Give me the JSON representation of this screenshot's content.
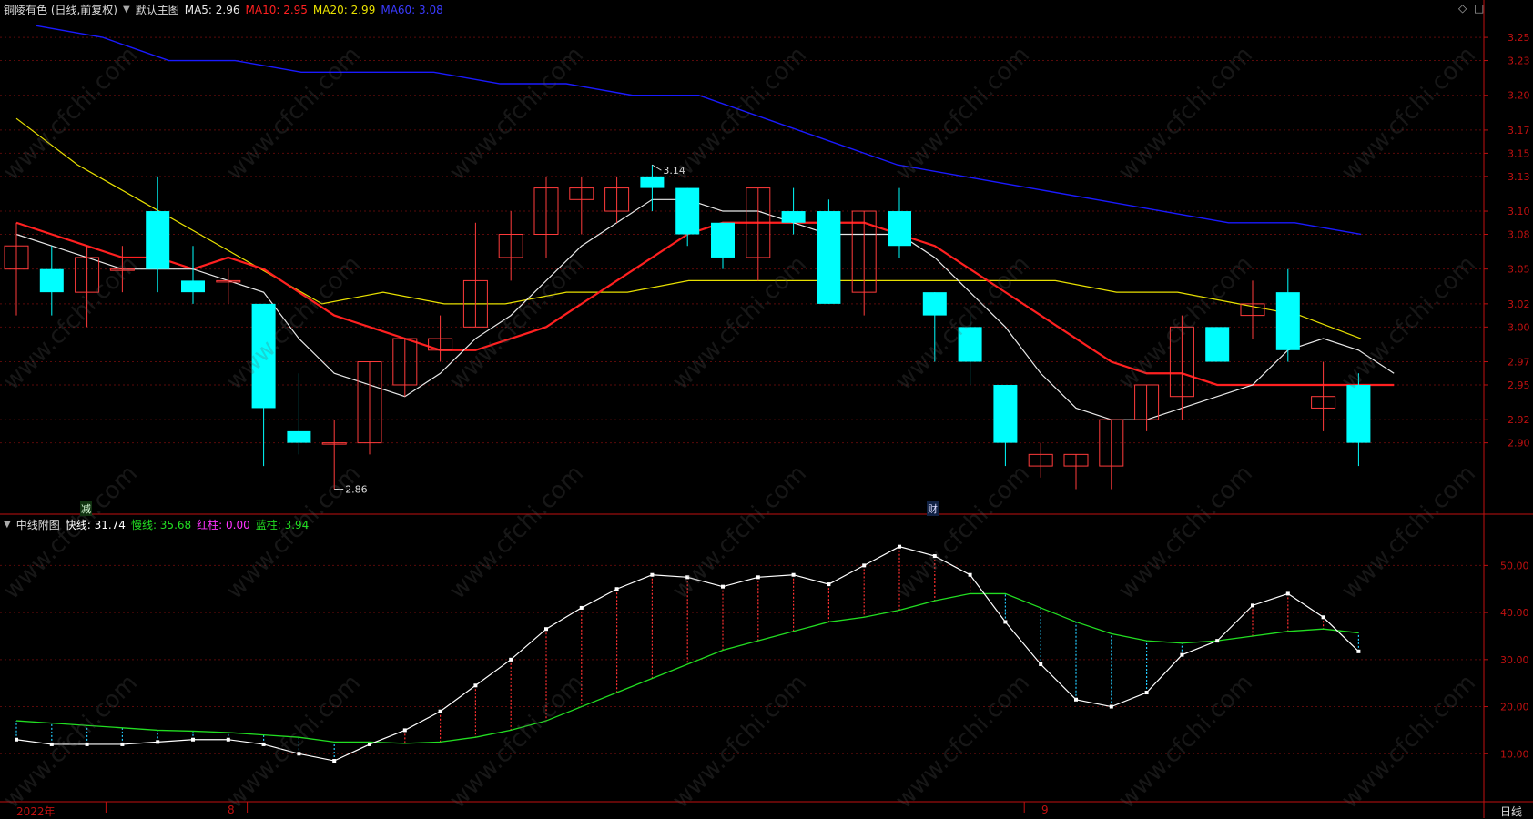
{
  "main_header": {
    "stock": "铜陵有色 (日线,前复权)",
    "template": "默认主图",
    "ma5": "MA5: 2.96",
    "ma10": "MA10: 2.95",
    "ma20": "MA20: 2.99",
    "ma60": "MA60: 3.08"
  },
  "sub_header": {
    "title": "中线附图",
    "fast": "快线: 31.74",
    "slow": "慢线: 35.68",
    "red": "红柱: 0.00",
    "blue": "蓝柱: 3.94"
  },
  "controls": {
    "diamond": "◇",
    "window": "□"
  },
  "markers": {
    "reduce": "减",
    "finance": "财"
  },
  "bottom_axis": {
    "year": "2022年",
    "m8": "8",
    "m9": "9",
    "period": "日线"
  },
  "colors": {
    "up": "#ff3b3b",
    "down": "#00ffff",
    "ma5": "#e8e8e8",
    "ma10": "#ff2020",
    "ma20": "#e8e000",
    "ma60": "#1a1aff",
    "fast": "#ffffff",
    "slow": "#22dd22",
    "axis": "#c01010",
    "grid": "#5a0a0a"
  },
  "watermark": "www.cfchi.com",
  "chart_data": [
    {
      "type": "candlestick",
      "title": "铜陵有色 (日线,前复权)",
      "y_ticks": [
        3.25,
        3.23,
        3.2,
        3.17,
        3.15,
        3.13,
        3.1,
        3.08,
        3.05,
        3.02,
        3.0,
        2.97,
        2.95,
        2.92,
        2.9
      ],
      "ylim": [
        2.84,
        3.265
      ],
      "high_label": "3.14",
      "low_label": "2.86",
      "candles": [
        {
          "o": 3.05,
          "h": 3.09,
          "l": 3.01,
          "c": 3.07
        },
        {
          "o": 3.05,
          "h": 3.07,
          "l": 3.01,
          "c": 3.03
        },
        {
          "o": 3.03,
          "h": 3.07,
          "l": 3.0,
          "c": 3.06
        },
        {
          "o": 3.05,
          "h": 3.07,
          "l": 3.03,
          "c": 3.05
        },
        {
          "o": 3.1,
          "h": 3.13,
          "l": 3.03,
          "c": 3.05
        },
        {
          "o": 3.04,
          "h": 3.07,
          "l": 3.02,
          "c": 3.03
        },
        {
          "o": 3.04,
          "h": 3.05,
          "l": 3.02,
          "c": 3.04
        },
        {
          "o": 3.02,
          "h": 3.02,
          "l": 2.88,
          "c": 2.93
        },
        {
          "o": 2.91,
          "h": 2.96,
          "l": 2.89,
          "c": 2.9
        },
        {
          "o": 2.9,
          "h": 2.92,
          "l": 2.86,
          "c": 2.9
        },
        {
          "o": 2.9,
          "h": 2.97,
          "l": 2.89,
          "c": 2.97
        },
        {
          "o": 2.95,
          "h": 2.99,
          "l": 2.94,
          "c": 2.99
        },
        {
          "o": 2.98,
          "h": 3.01,
          "l": 2.97,
          "c": 2.99
        },
        {
          "o": 3.0,
          "h": 3.09,
          "l": 3.0,
          "c": 3.04
        },
        {
          "o": 3.06,
          "h": 3.1,
          "l": 3.04,
          "c": 3.08
        },
        {
          "o": 3.08,
          "h": 3.13,
          "l": 3.06,
          "c": 3.12
        },
        {
          "o": 3.11,
          "h": 3.13,
          "l": 3.08,
          "c": 3.12
        },
        {
          "o": 3.1,
          "h": 3.13,
          "l": 3.09,
          "c": 3.12
        },
        {
          "o": 3.13,
          "h": 3.14,
          "l": 3.1,
          "c": 3.12
        },
        {
          "o": 3.12,
          "h": 3.12,
          "l": 3.07,
          "c": 3.08
        },
        {
          "o": 3.09,
          "h": 3.09,
          "l": 3.05,
          "c": 3.06
        },
        {
          "o": 3.06,
          "h": 3.12,
          "l": 3.04,
          "c": 3.12
        },
        {
          "o": 3.1,
          "h": 3.12,
          "l": 3.08,
          "c": 3.09
        },
        {
          "o": 3.1,
          "h": 3.11,
          "l": 3.02,
          "c": 3.02
        },
        {
          "o": 3.03,
          "h": 3.1,
          "l": 3.01,
          "c": 3.1
        },
        {
          "o": 3.1,
          "h": 3.12,
          "l": 3.06,
          "c": 3.07
        },
        {
          "o": 3.03,
          "h": 3.03,
          "l": 2.97,
          "c": 3.01
        },
        {
          "o": 3.0,
          "h": 3.01,
          "l": 2.95,
          "c": 2.97
        },
        {
          "o": 2.95,
          "h": 2.95,
          "l": 2.88,
          "c": 2.9
        },
        {
          "o": 2.88,
          "h": 2.9,
          "l": 2.87,
          "c": 2.89
        },
        {
          "o": 2.88,
          "h": 2.89,
          "l": 2.86,
          "c": 2.89
        },
        {
          "o": 2.88,
          "h": 2.92,
          "l": 2.86,
          "c": 2.92
        },
        {
          "o": 2.92,
          "h": 2.95,
          "l": 2.91,
          "c": 2.95
        },
        {
          "o": 2.94,
          "h": 3.01,
          "l": 2.92,
          "c": 3.0
        },
        {
          "o": 3.0,
          "h": 3.0,
          "l": 2.97,
          "c": 2.97
        },
        {
          "o": 3.01,
          "h": 3.04,
          "l": 2.99,
          "c": 3.02
        },
        {
          "o": 3.03,
          "h": 3.05,
          "l": 2.97,
          "c": 2.98
        },
        {
          "o": 2.93,
          "h": 2.97,
          "l": 2.91,
          "c": 2.94
        },
        {
          "o": 2.95,
          "h": 2.96,
          "l": 2.88,
          "c": 2.9
        }
      ],
      "ma5": [
        3.08,
        3.07,
        3.06,
        3.05,
        3.05,
        3.05,
        3.04,
        3.03,
        2.99,
        2.96,
        2.95,
        2.94,
        2.96,
        2.99,
        3.01,
        3.04,
        3.07,
        3.09,
        3.11,
        3.11,
        3.1,
        3.1,
        3.09,
        3.08,
        3.08,
        3.08,
        3.06,
        3.03,
        3.0,
        2.96,
        2.93,
        2.92,
        2.92,
        2.93,
        2.94,
        2.95,
        2.98,
        2.99,
        2.98,
        2.96
      ],
      "ma10": [
        3.09,
        3.08,
        3.07,
        3.06,
        3.06,
        3.05,
        3.06,
        3.05,
        3.03,
        3.01,
        3.0,
        2.99,
        2.98,
        2.98,
        2.99,
        3.0,
        3.02,
        3.04,
        3.06,
        3.08,
        3.09,
        3.09,
        3.09,
        3.09,
        3.09,
        3.08,
        3.07,
        3.05,
        3.03,
        3.01,
        2.99,
        2.97,
        2.96,
        2.96,
        2.95,
        2.95,
        2.95,
        2.95,
        2.95,
        2.95
      ],
      "ma20": [
        3.18,
        3.14,
        3.11,
        3.08,
        3.05,
        3.02,
        3.03,
        3.02,
        3.02,
        3.03,
        3.03,
        3.04,
        3.04,
        3.04,
        3.04,
        3.04,
        3.04,
        3.04,
        3.03,
        3.03,
        3.02,
        3.01,
        2.99
      ],
      "ma60": [
        3.26,
        3.25,
        3.23,
        3.23,
        3.22,
        3.22,
        3.22,
        3.21,
        3.21,
        3.2,
        3.2,
        3.18,
        3.16,
        3.14,
        3.13,
        3.12,
        3.11,
        3.1,
        3.09,
        3.09,
        3.08
      ]
    },
    {
      "type": "line",
      "title": "中线附图",
      "y_ticks": [
        50.0,
        40.0,
        30.0,
        20.0,
        10.0
      ],
      "ylim": [
        0,
        58
      ],
      "x": [
        "",
        "",
        "",
        "2022年",
        "",
        "",
        "",
        "8",
        "",
        "",
        "",
        "",
        "",
        "",
        "",
        "",
        "",
        "",
        "",
        "",
        "",
        "",
        "",
        "",
        "",
        "",
        "",
        "",
        "",
        "9",
        "",
        "",
        "",
        "",
        "",
        "",
        "",
        "",
        ""
      ],
      "series": [
        {
          "name": "快线",
          "values": [
            13,
            12,
            12,
            12,
            12.5,
            13,
            13,
            12,
            10,
            8.5,
            12,
            15,
            19,
            24.5,
            30,
            36.5,
            41,
            45,
            48,
            47.5,
            45.5,
            47.5,
            48,
            46,
            50,
            54,
            52,
            48,
            38,
            29,
            21.5,
            20,
            23,
            31,
            34,
            41.5,
            44,
            39,
            31.74
          ]
        },
        {
          "name": "慢线",
          "values": [
            17,
            16.5,
            16,
            15.5,
            15,
            14.8,
            14.5,
            14,
            13.5,
            12.5,
            12.5,
            12.2,
            12.5,
            13.5,
            15,
            17,
            20,
            23,
            26,
            29,
            32,
            34,
            36,
            38,
            39,
            40.5,
            42.5,
            44,
            44,
            41,
            38,
            35.5,
            34,
            33.5,
            34,
            35,
            36,
            36.5,
            35.68
          ]
        }
      ]
    }
  ]
}
